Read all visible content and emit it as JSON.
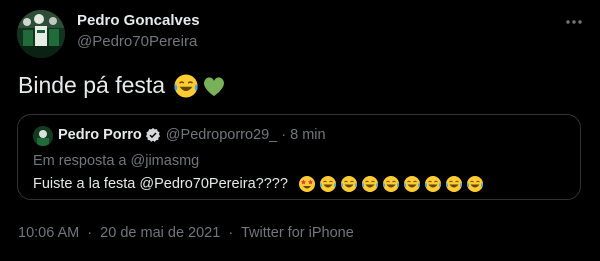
{
  "author": {
    "name": "Pedro Goncalves",
    "handle": "@Pedro70Pereira",
    "avatar_icon": "avatar-photo"
  },
  "more_icon": "more-horizontal-icon",
  "tweet": {
    "text": "Binde pá festa",
    "emojis": [
      "face-with-tears-of-joy",
      "green-heart"
    ]
  },
  "quoted": {
    "name": "Pedro Porro",
    "verified_icon": "verified-badge-icon",
    "handle": "@Pedroporro29_",
    "separator": "·",
    "time": "8 min",
    "reply_to": "Em resposta a @jimasmg",
    "text": "Fuiste a la festa @Pedro70Pereira????",
    "emojis": [
      "star-struck",
      "face-with-tears-of-joy",
      "face-with-tears-of-joy",
      "face-with-tears-of-joy",
      "face-with-tears-of-joy",
      "face-with-tears-of-joy",
      "face-with-tears-of-joy",
      "face-with-tears-of-joy",
      "face-with-tears-of-joy"
    ]
  },
  "meta": {
    "time": "10:06 AM",
    "separator": "·",
    "date": "20 de mai de 2021",
    "source": "Twitter for iPhone"
  },
  "colors": {
    "background": "#000000",
    "primary_text": "#e7e9ea",
    "secondary_text": "#71767b",
    "border": "#2f3336",
    "emoji_yellow": "#ffcc33",
    "tear_blue": "#4aa8e8",
    "heart_green": "#78b159"
  }
}
